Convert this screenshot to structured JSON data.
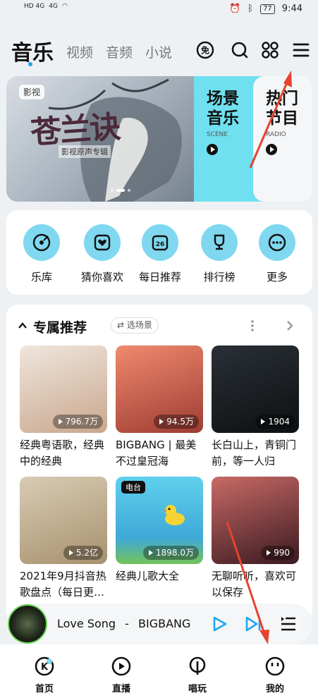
{
  "status_bar": {
    "sim1": "HD 4G",
    "sim2": "4G",
    "battery": "77",
    "time": "9:44"
  },
  "top_nav": {
    "tabs": [
      "音乐",
      "视频",
      "音频",
      "小说"
    ],
    "active_tab": "音乐"
  },
  "banner": {
    "tag": "影视",
    "title": "苍兰诀",
    "subtitle": "影视原声专辑",
    "cards": [
      {
        "title": "场景音乐",
        "en": "SCENE"
      },
      {
        "title": "热门节目",
        "en": "RADIO"
      }
    ]
  },
  "shortcuts": [
    {
      "label": "乐库",
      "icon": "music-disc-icon"
    },
    {
      "label": "猜你喜欢",
      "icon": "heart-box-icon"
    },
    {
      "label": "每日推荐",
      "icon": "calendar-icon",
      "day": "26"
    },
    {
      "label": "排行榜",
      "icon": "trophy-icon"
    },
    {
      "label": "更多",
      "icon": "more-dots-icon"
    }
  ],
  "recommendations": {
    "title": "专属推荐",
    "scene_button": "选场景",
    "items": [
      {
        "caption": "经典粤语歌，经典中的经典",
        "plays": "796.7万",
        "badge": "",
        "color": "#e7dcd2"
      },
      {
        "caption": "BIGBANG | 最美不过皇冠海",
        "plays": "94.5万",
        "badge": "",
        "color": "#d86d5a"
      },
      {
        "caption": "长白山上，青铜门前，等一人归",
        "plays": "1904",
        "badge": "",
        "color": "#1b1f22"
      },
      {
        "caption": "2021年9月抖音热歌盘点（每日更…",
        "plays": "5.2亿",
        "badge": "",
        "color": "#c9b79d"
      },
      {
        "caption": "经典儿歌大全",
        "plays": "1898.0万",
        "badge": "电台",
        "color": "#5cc2e6"
      },
      {
        "caption": "无聊听听，喜欢可以保存",
        "plays": "990",
        "badge": "",
        "color": "#8a3b3d"
      }
    ]
  },
  "player": {
    "song": "Love Song",
    "artist": "BIGBANG",
    "separator": "-"
  },
  "bottom_nav": [
    {
      "label": "首页",
      "icon": "home-k-icon"
    },
    {
      "label": "直播",
      "icon": "live-play-icon"
    },
    {
      "label": "唱玩",
      "icon": "mic-icon"
    },
    {
      "label": "我的",
      "icon": "profile-face-icon"
    }
  ],
  "colors": {
    "accent": "#1ea4f4",
    "bubble": "#7fd8ef",
    "annotation": "#e8432f"
  }
}
